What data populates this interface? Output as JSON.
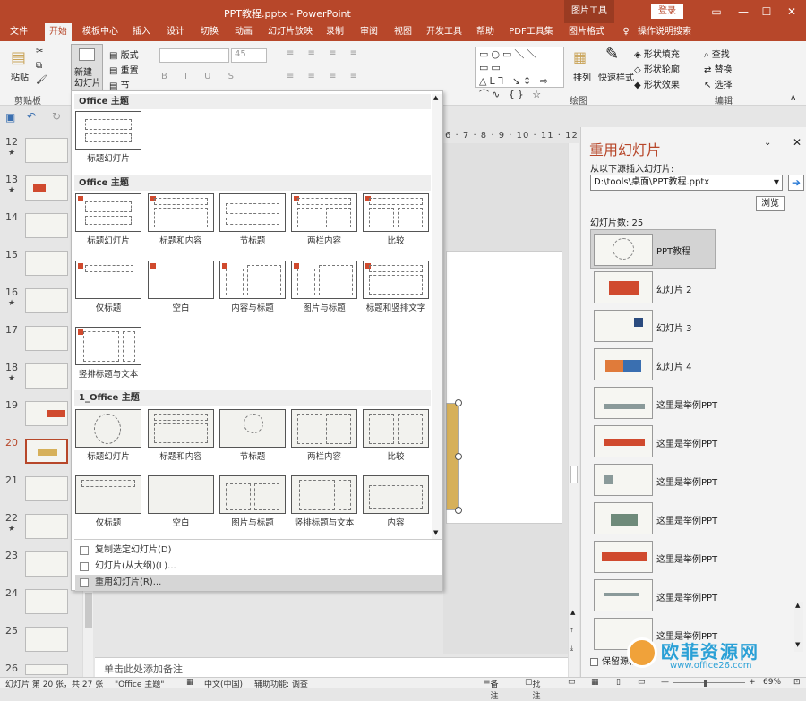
{
  "app": {
    "title": "PPT教程.pptx  -  PowerPoint",
    "context_tab_group": "图片工具",
    "login": "登录",
    "window_buttons": [
      "☐",
      "—",
      "☐",
      "✕"
    ]
  },
  "tabs": [
    "文件",
    "开始",
    "模板中心",
    "插入",
    "设计",
    "切换",
    "动画",
    "幻灯片放映",
    "录制",
    "审阅",
    "视图",
    "开发工具",
    "帮助",
    "PDF工具集",
    "图片格式",
    "操作说明搜索"
  ],
  "active_tab": "开始",
  "ribbon": {
    "paste": "粘贴",
    "clipboard": "剪贴板",
    "new_slide": "新建\n幻灯片",
    "layout": "版式",
    "reset": "重置",
    "section": "节",
    "font_size": "45",
    "drawing": "绘图",
    "arrange": "排列",
    "quick_styles": "快速样式",
    "shape_fill": "形状填充",
    "shape_outline": "形状轮廓",
    "shape_effects": "形状效果",
    "find": "查找",
    "replace": "替换",
    "select": "选择",
    "editing": "编辑"
  },
  "thumbnails": [
    {
      "num": "12",
      "star": true
    },
    {
      "num": "13",
      "star": true
    },
    {
      "num": "14",
      "star": false
    },
    {
      "num": "15",
      "star": false
    },
    {
      "num": "16",
      "star": true
    },
    {
      "num": "17",
      "star": false
    },
    {
      "num": "18",
      "star": true
    },
    {
      "num": "19",
      "star": false
    },
    {
      "num": "20",
      "star": false,
      "selected": true
    },
    {
      "num": "21",
      "star": false
    },
    {
      "num": "22",
      "star": true
    },
    {
      "num": "23",
      "star": false
    },
    {
      "num": "24",
      "star": false
    },
    {
      "num": "25",
      "star": false
    },
    {
      "num": "26",
      "star": false
    }
  ],
  "ruler": "6 · 7 · 8 · 9 · 10 · 11 · 12",
  "dropdown": {
    "sections": [
      "Office 主题",
      "Office 主题",
      "1_Office 主题"
    ],
    "section1_layouts": [
      "标题幻灯片"
    ],
    "section2_layouts": [
      "标题幻灯片",
      "标题和内容",
      "节标题",
      "两栏内容",
      "比较",
      "仅标题",
      "空白",
      "内容与标题",
      "图片与标题",
      "标题和竖排文字",
      "竖排标题与文本"
    ],
    "section3_layouts": [
      "标题幻灯片",
      "标题和内容",
      "节标题",
      "两栏内容",
      "比较",
      "仅标题",
      "空白",
      "图片与标题",
      "竖排标题与文本",
      "内容"
    ],
    "menu": [
      "复制选定幻灯片(D)",
      "幻灯片(从大纲)(L)...",
      "重用幻灯片(R)..."
    ]
  },
  "notes_placeholder": "单击此处添加备注",
  "reuse_panel": {
    "title": "重用幻灯片",
    "source_label": "从以下源插入幻灯片:",
    "source_path": "D:\\tools\\桌面\\PPT教程.pptx",
    "browse": "浏览",
    "count_label": "幻灯片数: 25",
    "slides": [
      "PPT教程",
      "幻灯片 2",
      "幻灯片 3",
      "幻灯片 4",
      "这里是举例PPT",
      "这里是举例PPT",
      "这里是举例PPT",
      "这里是举例PPT",
      "这里是举例PPT",
      "这里是举例PPT",
      "这里是举例PPT"
    ],
    "keep_format": "保留源格式"
  },
  "status": {
    "slide_info": "幻灯片 第 20 张，共 27 张",
    "theme": "\"Office 主题\"",
    "language": "中文(中国)",
    "accessibility": "辅助功能: 调查",
    "notes": "备注",
    "comments": "批注",
    "zoom": "69%"
  },
  "watermark": {
    "brand": "欧菲资源网",
    "url": "www.office26.com"
  }
}
